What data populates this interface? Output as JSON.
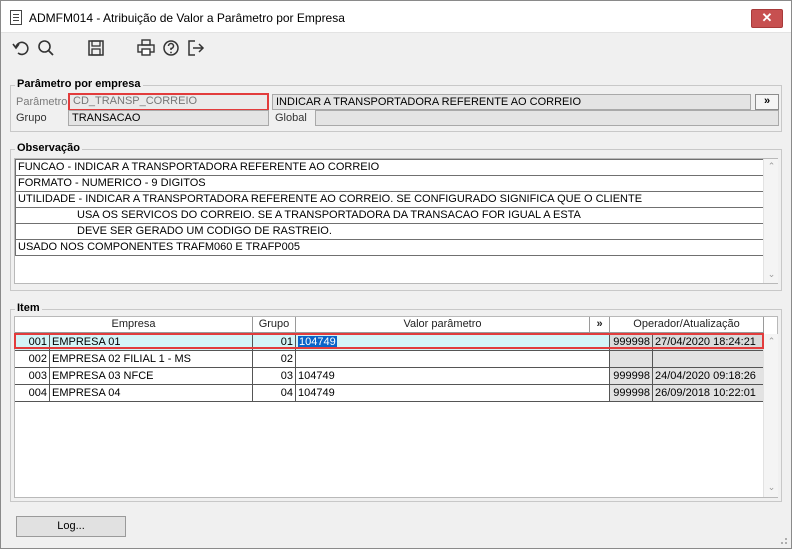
{
  "window": {
    "title": "ADMFM014 - Atribuição de Valor a Parâmetro por Empresa",
    "close_label": "✕"
  },
  "toolbar": {
    "icons": [
      "undo-icon",
      "search-icon",
      "save-icon",
      "print-icon",
      "help-icon",
      "exit-icon"
    ]
  },
  "param_group": {
    "title": "Parâmetro por empresa",
    "param_label": "Parâmetro",
    "param_value": "CD_TRANSP_CORREIO",
    "param_desc": "INDICAR A TRANSPORTADORA REFERENTE AO CORREIO",
    "expand_label": "»",
    "group_label": "Grupo",
    "group_value": "TRANSACAO",
    "global_label": "Global",
    "global_value": ""
  },
  "obs_group": {
    "title": "Observação",
    "lines": [
      "FUNCAO - INDICAR A TRANSPORTADORA REFERENTE AO CORREIO",
      "FORMATO - NUMERICO - 9 DIGITOS",
      "UTILIDADE - INDICAR A TRANSPORTADORA REFERENTE AO CORREIO. SE CONFIGURADO SIGNIFICA QUE O CLIENTE",
      "USA OS SERVICOS DO CORREIO. SE A TRANSPORTADORA DA TRANSACAO FOR IGUAL A ESTA",
      "DEVE SER GERADO UM CODIGO DE RASTREIO.",
      "USADO NOS COMPONENTES TRAFM060  E  TRAFP005"
    ]
  },
  "item_group": {
    "title": "Item",
    "headers": {
      "empresa": "Empresa",
      "grupo": "Grupo",
      "valor": "Valor parâmetro",
      "expand": "»",
      "operador": "Operador/Atualização"
    },
    "rows": [
      {
        "code": "001",
        "name": "EMPRESA 01",
        "grupo": "01",
        "valor": "104749",
        "operador": "999998",
        "data": "27/04/2020 18:24:21"
      },
      {
        "code": "002",
        "name": "EMPRESA 02 FILIAL 1 - MS",
        "grupo": "02",
        "valor": "",
        "operador": "",
        "data": ""
      },
      {
        "code": "003",
        "name": "EMPRESA 03 NFCE",
        "grupo": "03",
        "valor": "104749",
        "operador": "999998",
        "data": "24/04/2020 09:18:26"
      },
      {
        "code": "004",
        "name": "EMPRESA 04",
        "grupo": "04",
        "valor": "104749",
        "operador": "999998",
        "data": "26/09/2018 10:22:01"
      }
    ]
  },
  "footer": {
    "log_label": "Log..."
  }
}
